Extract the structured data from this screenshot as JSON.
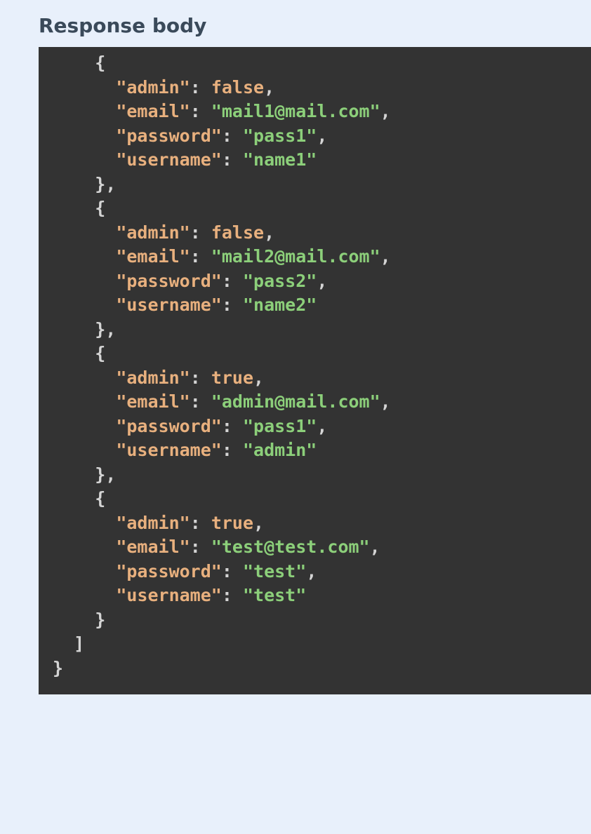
{
  "section": {
    "title": "Response body"
  },
  "response": {
    "items": [
      {
        "admin": false,
        "email": "mail1@mail.com",
        "password": "pass1",
        "username": "name1"
      },
      {
        "admin": false,
        "email": "mail2@mail.com",
        "password": "pass2",
        "username": "name2"
      },
      {
        "admin": true,
        "email": "admin@mail.com",
        "password": "pass1",
        "username": "admin"
      },
      {
        "admin": true,
        "email": "test@test.com",
        "password": "test",
        "username": "test"
      }
    ]
  },
  "keys": {
    "admin": "admin",
    "email": "email",
    "password": "password",
    "username": "username"
  }
}
